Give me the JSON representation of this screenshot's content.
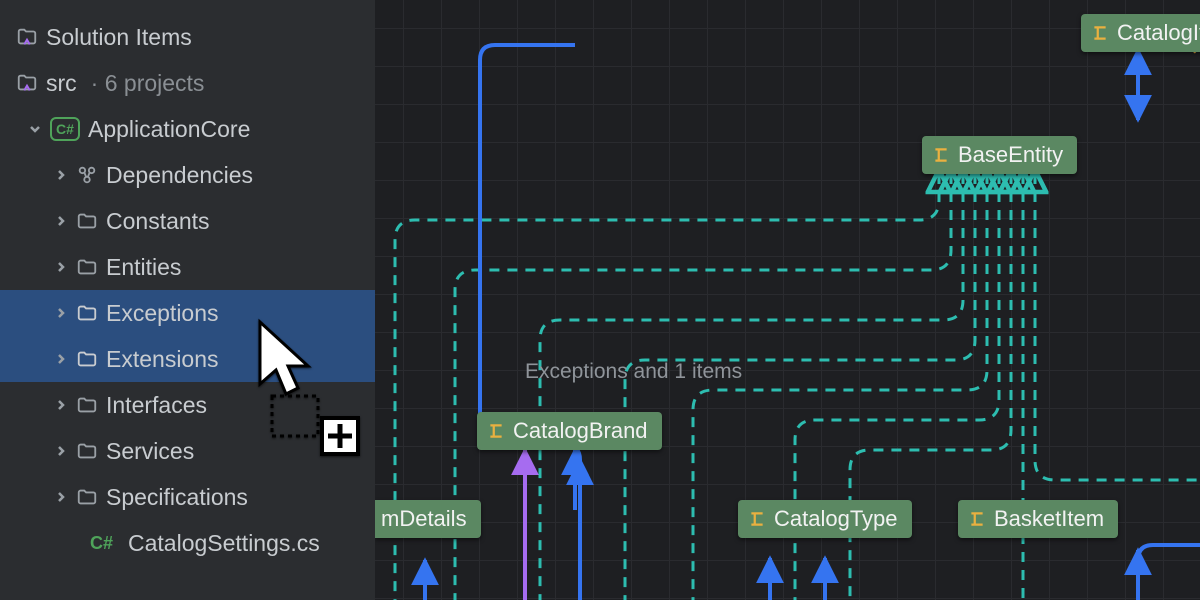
{
  "sidebar": {
    "solution_items": "Solution Items",
    "src": "src",
    "src_meta": "· 6 projects",
    "project": "ApplicationCore",
    "items": [
      {
        "label": "Dependencies"
      },
      {
        "label": "Constants"
      },
      {
        "label": "Entities"
      },
      {
        "label": "Exceptions"
      },
      {
        "label": "Extensions"
      },
      {
        "label": "Interfaces"
      },
      {
        "label": "Services"
      },
      {
        "label": "Specifications"
      }
    ],
    "file": "CatalogSettings.cs"
  },
  "diagram": {
    "caption": "Exceptions and 1 items",
    "nodes": {
      "base_entity": "BaseEntity",
      "catalog_item": "CatalogIt",
      "catalog_brand": "CatalogBrand",
      "catalog_type": "CatalogType",
      "basket_item": "BasketItem",
      "m_details": "mDetails"
    }
  },
  "colors": {
    "blue": "#3574f0",
    "teal": "#2dbdb0",
    "purple": "#a66cf0",
    "orange": "#eab040",
    "node": "#5b8862"
  }
}
